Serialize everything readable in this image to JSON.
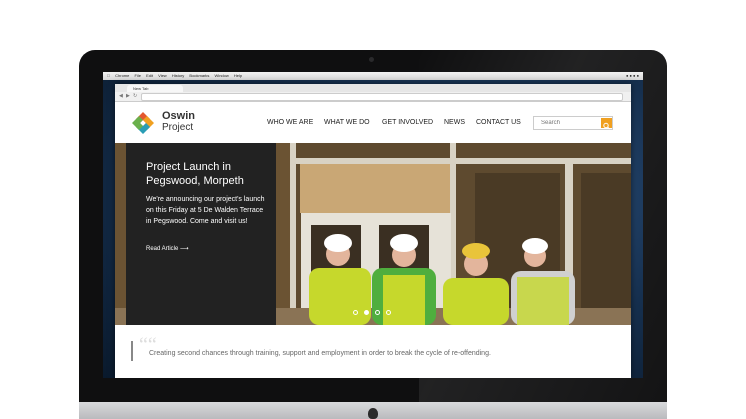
{
  "osx_menubar": {
    "items": [
      "Chrome",
      "File",
      "Edit",
      "View",
      "History",
      "Bookmarks",
      "Window",
      "Help"
    ]
  },
  "browser": {
    "tab_title": "New Tab"
  },
  "site": {
    "logo": {
      "line1": "Oswin",
      "line2": "Project"
    },
    "nav": [
      "WHO WE ARE",
      "WHAT WE DO",
      "GET INVOLVED",
      "NEWS",
      "CONTACT US"
    ],
    "search": {
      "placeholder": "Search"
    },
    "hero": {
      "title": "Project Launch in Pegswood, Morpeth",
      "body": "We're announcing our project's launch on this Friday at 5 De Walden Terrace in Pegswood. Come and visit us!",
      "link": "Read Article ⟶",
      "slide_count": 4,
      "active_slide": 2
    },
    "quote": {
      "text": "Creating second chances through training, support and employment in order to break the cycle of re-offending."
    }
  },
  "colors": {
    "accent": "#f0a020",
    "caption_bg": "#222222"
  }
}
